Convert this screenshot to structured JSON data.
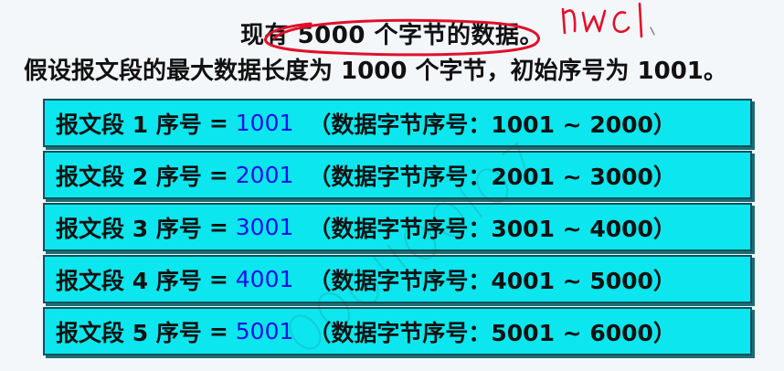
{
  "intro": {
    "line1": "现有 5000 个字节的数据。",
    "line2": "假设报文段的最大数据长度为 1000 个字节，初始序号为 1001。"
  },
  "segments": [
    {
      "label": "报文段 1 序号",
      "eq": "=",
      "seq": "1001",
      "detail": "（数据字节序号：1001 ~ 2000）"
    },
    {
      "label": "报文段 2 序号",
      "eq": "=",
      "seq": "2001",
      "detail": "（数据字节序号：2001 ~ 3000）"
    },
    {
      "label": "报文段 3 序号",
      "eq": "=",
      "seq": "3001",
      "detail": "（数据字节序号：3001 ~ 4000）"
    },
    {
      "label": "报文段 4 序号",
      "eq": "=",
      "seq": "4001",
      "detail": "（数据字节序号：4001 ~ 5000）"
    },
    {
      "label": "报文段 5 序号",
      "eq": "=",
      "seq": "5001",
      "detail": "（数据字节序号：5001 ~ 6000）"
    }
  ],
  "colors": {
    "segment_fill": "#0ce6ee",
    "segment_border": "#11525a",
    "sequence_number": "#1a10e6",
    "annotation_ink": "#e0102a"
  }
}
